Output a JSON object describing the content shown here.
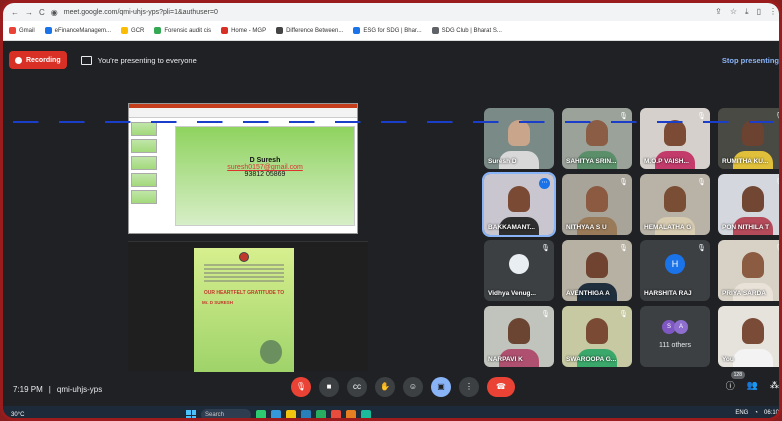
{
  "browser": {
    "url": "meet.google.com/qmi-uhjs-yps?pli=1&authuser=0",
    "bookmarks": [
      {
        "label": "Gmail",
        "color": "#ea4335"
      },
      {
        "label": "eFinanceManagem...",
        "color": "#1a73e8"
      },
      {
        "label": "GCR",
        "color": "#fbbc04"
      },
      {
        "label": "Forensic audit cis",
        "color": "#34a853"
      },
      {
        "label": "Home - MGP",
        "color": "#d93025"
      },
      {
        "label": "Difference Between...",
        "color": "#444444"
      },
      {
        "label": "ESG for SDG | Bhar...",
        "color": "#1a73e8"
      },
      {
        "label": "SDG Club | Bharat S...",
        "color": "#5f6368"
      }
    ]
  },
  "meet": {
    "recording_label": "Recording",
    "presenting_label": "You're presenting to everyone",
    "stop_label": "Stop presenting",
    "slide": {
      "name": "D Suresh",
      "email": "suresh0157@gmail.com",
      "phone": "93812 05869"
    },
    "poster": {
      "gratitude": "OUR HEARTFELT GRATITUDE TO",
      "honoree": "Mr. D SURESH"
    },
    "participants": [
      {
        "name": "Suresh D",
        "mic_off": false
      },
      {
        "name": "SAHITYA SRIN...",
        "mic_off": true
      },
      {
        "name": "M.O.P VAISH...",
        "mic_off": true
      },
      {
        "name": "RUMITHA KU...",
        "mic_off": true
      },
      {
        "name": "BAKKAMANT...",
        "mic_off": false
      },
      {
        "name": "NITHYAA S U",
        "mic_off": true
      },
      {
        "name": "HEMALATHA G",
        "mic_off": true
      },
      {
        "name": "PON NITHILA T",
        "mic_off": true
      },
      {
        "name": "Vidhya Venug...",
        "mic_off": true
      },
      {
        "name": "AVENTHIGA A",
        "mic_off": true
      },
      {
        "name": "HARSHITA RAJ",
        "mic_off": true,
        "initial": "H"
      },
      {
        "name": "PRIYA SARDA",
        "mic_off": true
      },
      {
        "name": "NARPAVI K",
        "mic_off": true
      },
      {
        "name": "SWAROOPA G...",
        "mic_off": true
      },
      {
        "name": "111 others",
        "initials": [
          "S",
          "A"
        ]
      },
      {
        "name": "You",
        "mic_off": false
      }
    ],
    "time": "7:19 PM",
    "separator": "|",
    "meeting_code": "qmi-uhjs-yps",
    "participant_count": "128"
  },
  "taskbar": {
    "weather": "30°C",
    "search": "Search",
    "tray": [
      "ENG",
      "06:10"
    ]
  }
}
